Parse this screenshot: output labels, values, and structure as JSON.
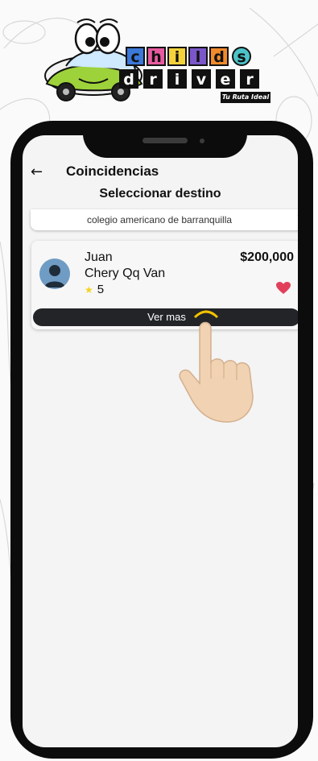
{
  "logo": {
    "row1": [
      "c",
      "h",
      "i",
      "l",
      "d",
      "s"
    ],
    "row2": [
      "d",
      "r",
      "i",
      "v",
      "e",
      "r"
    ],
    "tagline": "Tu Ruta Ideal",
    "colors": [
      "#3b78d8",
      "#e85aa0",
      "#f4d33a",
      "#7a56c8",
      "#f08a2a",
      "#4cc3c9"
    ]
  },
  "header": {
    "back_icon": "arrow-left-icon",
    "title": "Coincidencias",
    "subtitle": "Seleccionar destino"
  },
  "destination": {
    "selected": "colegio americano de barranquilla"
  },
  "results": [
    {
      "name": "Juan",
      "vehicle": "Chery Qq Van",
      "price": "$200,000",
      "rating": "5",
      "favorite": true,
      "button_label": "Ver mas"
    }
  ],
  "colors": {
    "favorite": "#e2405a",
    "star": "#f5d31c",
    "button": "#222428",
    "phone_frame": "#0c0c0c"
  }
}
